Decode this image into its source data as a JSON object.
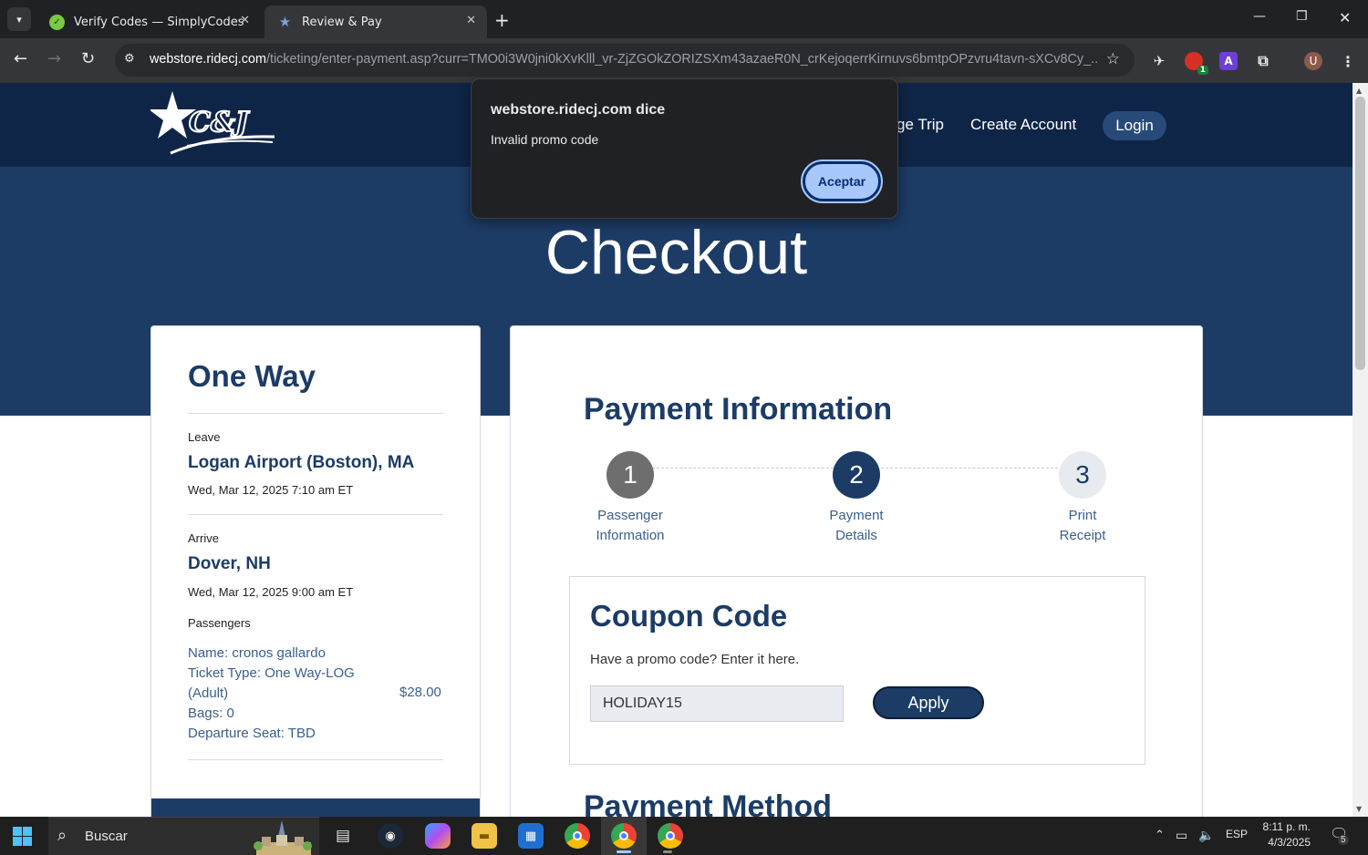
{
  "browser": {
    "tabs": [
      {
        "title": "Verify Codes — SimplyCodes",
        "close": "✕"
      },
      {
        "title": "Review & Pay",
        "close": "✕"
      }
    ],
    "new_tab": "+",
    "url_host": "webstore.ridecj.com",
    "url_rest": "/ticketing/enter-payment.asp?curr=TMO0i3W0jni0kXvKlll_vr-ZjZGOkZORIZSXm43azaeR0N_crKejoqerrKirnuvs6bmtpOPzvru4tavn-sXCv8Cy_...",
    "profile_initial": "U",
    "ext_badge": "1",
    "ext_letter": "A"
  },
  "site": {
    "logo_text": "C&J",
    "nav": {
      "manage_trip": "ge Trip",
      "create_account": "Create Account",
      "login": "Login"
    },
    "hero_title": "Checkout"
  },
  "trip": {
    "type": "One Way",
    "leave_label": "Leave",
    "leave_place": "Logan Airport (Boston), MA",
    "leave_time": "Wed, Mar 12, 2025 7:10 am ET",
    "arrive_label": "Arrive",
    "arrive_place": "Dover, NH",
    "arrive_time": "Wed, Mar 12, 2025 9:00 am ET",
    "passengers_label": "Passengers",
    "passenger": {
      "name": "Name: cronos gallardo",
      "ticket_type": "Ticket Type: One Way-LOG",
      "adult": "(Adult)",
      "price": "$28.00",
      "bags": "Bags: 0",
      "seat": "Departure Seat: TBD"
    }
  },
  "payment": {
    "title": "Payment Information",
    "steps": [
      {
        "number": "1",
        "line1": "Passenger",
        "line2": "Information"
      },
      {
        "number": "2",
        "line1": "Payment",
        "line2": "Details"
      },
      {
        "number": "3",
        "line1": "Print",
        "line2": "Receipt"
      }
    ],
    "coupon": {
      "title": "Coupon Code",
      "hint": "Have a promo code? Enter it here.",
      "value": "HOLIDAY15",
      "apply": "Apply"
    },
    "method_title": "Payment Method"
  },
  "dialog": {
    "title": "webstore.ridecj.com dice",
    "message": "Invalid promo code",
    "ok": "Aceptar"
  },
  "taskbar": {
    "search_placeholder": "Buscar",
    "lang": "ESP",
    "time": "8:11 p. m.",
    "date": "4/3/2025",
    "notif_count": "5"
  },
  "colors": {
    "navy": "#0f2547",
    "hero": "#1c3c66",
    "dialog_button": "#a8c7fa",
    "step_done": "#6e6e6e",
    "step_current": "#1c3c66",
    "step_next": "#e7ebf0"
  }
}
